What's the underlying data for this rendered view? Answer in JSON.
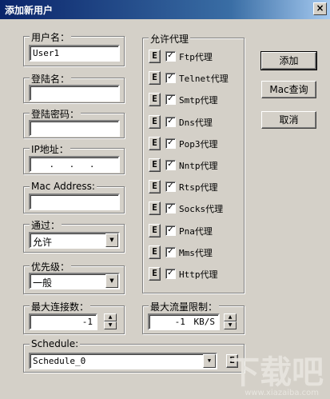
{
  "window": {
    "title": "添加新用户",
    "close_label": "×"
  },
  "fields": {
    "username": {
      "label": "用户名：",
      "value": "User1"
    },
    "login_name": {
      "label": "登陆名：",
      "value": ""
    },
    "login_password": {
      "label": "登陆密码：",
      "value": ""
    },
    "ip_address": {
      "label": "IP地址：",
      "value": ". . ."
    },
    "mac_address": {
      "label": "Mac Address:",
      "value": ""
    },
    "pass": {
      "label": "通过：",
      "value": "允许"
    },
    "priority": {
      "label": "优先级：",
      "value": "一般"
    },
    "max_connections": {
      "label": "最大连接数：",
      "value": "-1"
    },
    "max_traffic": {
      "label": "最大流量限制：",
      "value": "-1",
      "unit": "KB/S"
    },
    "schedule": {
      "label": "Schedule:",
      "value": "Schedule_0"
    }
  },
  "proxy_group": {
    "label": "允许代理",
    "edit_label": "E",
    "check_mark": "✓",
    "items": [
      {
        "label": "Ftp代理",
        "checked": true
      },
      {
        "label": "Telnet代理",
        "checked": true
      },
      {
        "label": "Smtp代理",
        "checked": true
      },
      {
        "label": "Dns代理",
        "checked": true
      },
      {
        "label": "Pop3代理",
        "checked": true
      },
      {
        "label": "Nntp代理",
        "checked": true
      },
      {
        "label": "Rtsp代理",
        "checked": true
      },
      {
        "label": "Socks代理",
        "checked": true
      },
      {
        "label": "Pna代理",
        "checked": true
      },
      {
        "label": "Mms代理",
        "checked": true
      },
      {
        "label": "Http代理",
        "checked": true
      }
    ]
  },
  "buttons": {
    "add": "添加",
    "mac_query": "Mac查询",
    "cancel": "取消"
  },
  "icons": {
    "dropdown": "▼",
    "spin_up": "▲",
    "spin_down": "▼"
  },
  "watermark": {
    "text": "下载吧",
    "url": "www.xiazaiba.com"
  }
}
